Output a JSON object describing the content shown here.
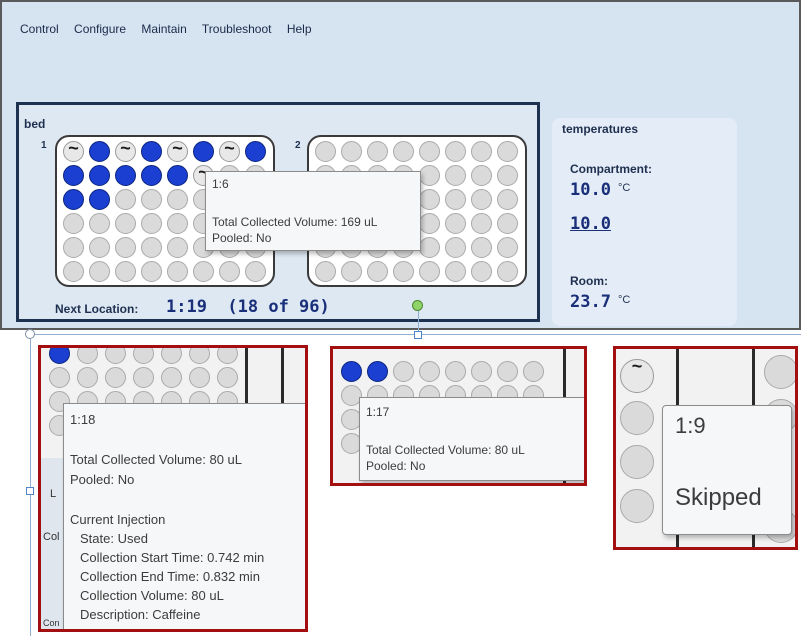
{
  "menu": [
    "Control",
    "Configure",
    "Maintain",
    "Troubleshoot",
    "Help"
  ],
  "bed": {
    "title": "bed",
    "plate1_number": "1",
    "plate2_number": "2",
    "next_location_label": "Next Location:",
    "next_location_value": "1:19  (18 of 96)"
  },
  "temperatures": {
    "title": "temperatures",
    "compartment_label": "Compartment:",
    "compartment_value": "10.0",
    "compartment_unit": "°C",
    "compartment_setpoint": "10.0",
    "room_label": "Room:",
    "room_value": "23.7",
    "room_unit": "°C"
  },
  "tooltip_main": {
    "location": "1:6",
    "volume": "Total Collected Volume: 169 uL",
    "pooled": "Pooled: No"
  },
  "tooltip_118": {
    "location": "1:18",
    "volume": "Total Collected Volume: 80 uL",
    "pooled": "Pooled: No",
    "injection_title": "Current Injection",
    "state": "State: Used",
    "start": "Collection Start Time: 0.742 min",
    "end": "Collection End Time: 0.832 min",
    "cvolume": "Collection Volume: 80 uL",
    "description": "Description: Caffeine"
  },
  "tooltip_117": {
    "location": "1:17",
    "volume": "Total Collected Volume: 80 uL",
    "pooled": "Pooled: No"
  },
  "tooltip_19": {
    "location": "1:9",
    "status": "Skipped"
  },
  "fragments": {
    "l": "L",
    "col": "Col",
    "con": "Con"
  },
  "colors": {
    "filled_well": "#1a3fd1",
    "empty_well": "#dadada",
    "highlight_frame": "#a30f10",
    "panel_border": "#1d3150"
  },
  "plate1_wells": [
    [
      "skip",
      "filled",
      "skip",
      "filled",
      "skip",
      "filled",
      "skip",
      "filled"
    ],
    [
      "filled",
      "filled",
      "filled",
      "filled",
      "filled",
      "skip",
      "empty",
      "empty"
    ],
    [
      "filled",
      "filled",
      "empty",
      "empty",
      "empty",
      "empty",
      "empty",
      "empty"
    ],
    [
      "empty",
      "empty",
      "empty",
      "empty",
      "empty",
      "empty",
      "empty",
      "empty"
    ],
    [
      "empty",
      "empty",
      "empty",
      "empty",
      "empty",
      "empty",
      "empty",
      "empty"
    ],
    [
      "empty",
      "empty",
      "empty",
      "empty",
      "empty",
      "empty",
      "empty",
      "empty"
    ]
  ]
}
